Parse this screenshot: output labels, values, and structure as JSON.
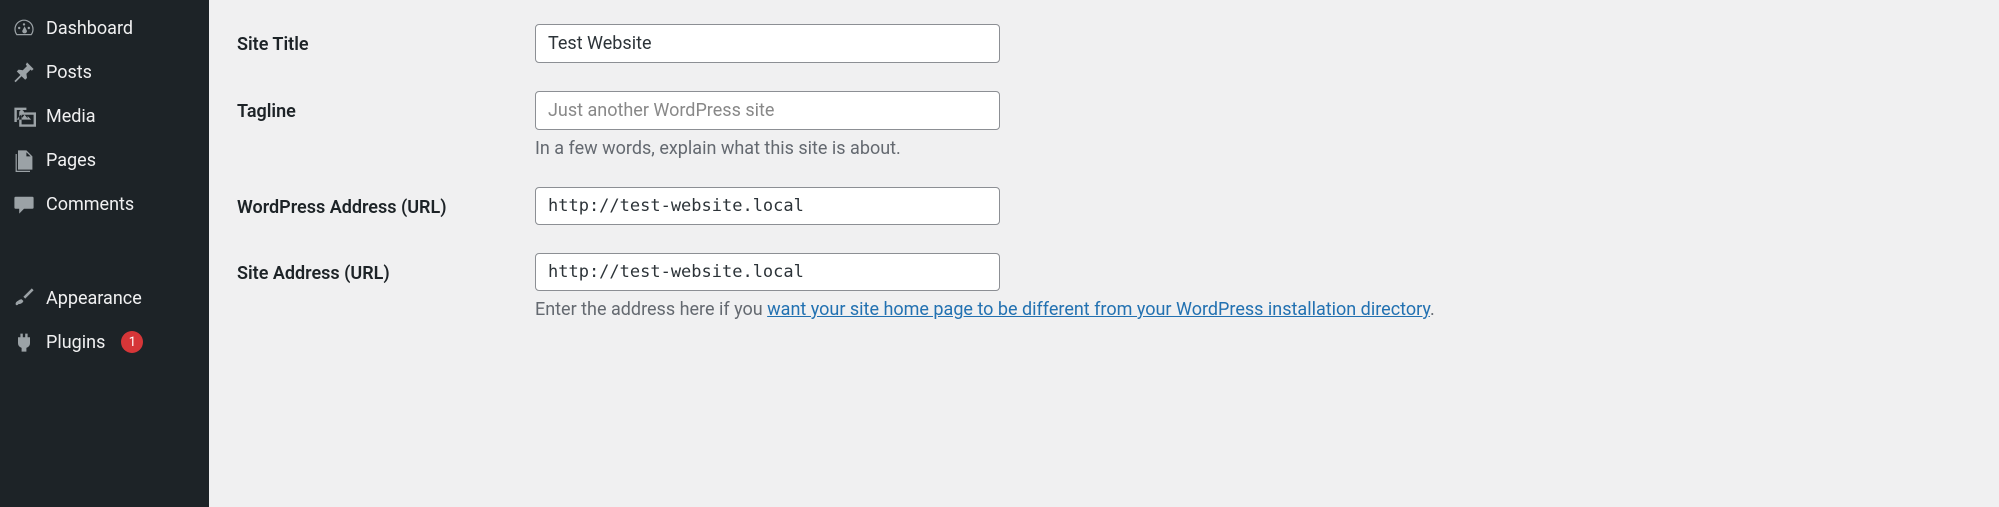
{
  "sidebar": {
    "items": [
      {
        "label": "Dashboard",
        "icon": "dashboard-icon"
      },
      {
        "label": "Posts",
        "icon": "pin-icon"
      },
      {
        "label": "Media",
        "icon": "media-icon"
      },
      {
        "label": "Pages",
        "icon": "pages-icon"
      },
      {
        "label": "Comments",
        "icon": "comments-icon"
      },
      {
        "label": "Appearance",
        "icon": "brush-icon"
      },
      {
        "label": "Plugins",
        "icon": "plug-icon",
        "badge": "1"
      }
    ]
  },
  "form": {
    "site_title": {
      "label": "Site Title",
      "value": "Test Website"
    },
    "tagline": {
      "label": "Tagline",
      "placeholder": "Just another WordPress site",
      "description": "In a few words, explain what this site is about."
    },
    "wp_address": {
      "label": "WordPress Address (URL)",
      "value": "http://test-website.local"
    },
    "site_address": {
      "label": "Site Address (URL)",
      "value": "http://test-website.local",
      "description_prefix": "Enter the address here if you ",
      "description_link": "want your site home page to be different from your WordPress installation directory",
      "description_suffix": "."
    }
  }
}
